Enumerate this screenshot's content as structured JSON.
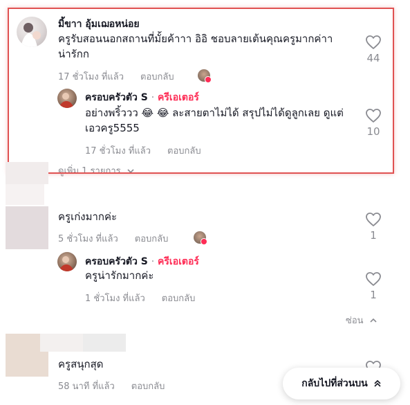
{
  "comment1": {
    "username": "มิ้ขาา อุ้มเฌอหน่อย",
    "text": "ครูรับสอนนอกสถานที่มั้ยค้าาา อิอิ ชอบลายเต้นคุณครูมากค่าา น่ารักก",
    "time": "17 ชั่วโมง ที่แล้ว",
    "reply_label": "ตอบกลับ",
    "likes": "44",
    "reply": {
      "username": "ครอบครัวตัว S",
      "dot": "·",
      "creator_label": "ครีเอเตอร์",
      "text": "อย่างพริ้ววว 😂 😂 ละสายตาไม่ได้ สรุปไม่ได้ดูลูกเลย ดูแต่เอวครู5555",
      "time": "17 ชั่วโมง ที่แล้ว",
      "reply_label": "ตอบกลับ",
      "likes": "10"
    },
    "view_more": "ดูเพิ่ม 1 รายการ"
  },
  "comment2": {
    "text": "ครูเก่งมากค่ะ",
    "time": "5 ชั่วโมง ที่แล้ว",
    "reply_label": "ตอบกลับ",
    "likes": "1",
    "reply": {
      "username": "ครอบครัวตัว S",
      "dot": "·",
      "creator_label": "ครีเอเตอร์",
      "text": "ครูน่ารักมากค่ะ",
      "time": "1 ชั่วโมง ที่แล้ว",
      "reply_label": "ตอบกลับ",
      "likes": "1"
    },
    "hide_label": "ซ่อน"
  },
  "comment3": {
    "text": "ครูสนุกสุด",
    "time": "58 นาที ที่แล้ว",
    "reply_label": "ตอบกลับ"
  },
  "back_to_top": "กลับไปที่ส่วนบน",
  "icons": {
    "heart": "heart-outline-icon",
    "chevron_down": "chevron-down-icon",
    "chevron_up": "chevron-up-icon",
    "double_chevron_up": "double-chevron-up-icon"
  },
  "colors": {
    "creator": "#fe2c55",
    "highlight": "#e05252",
    "muted": "#8a8b91"
  }
}
